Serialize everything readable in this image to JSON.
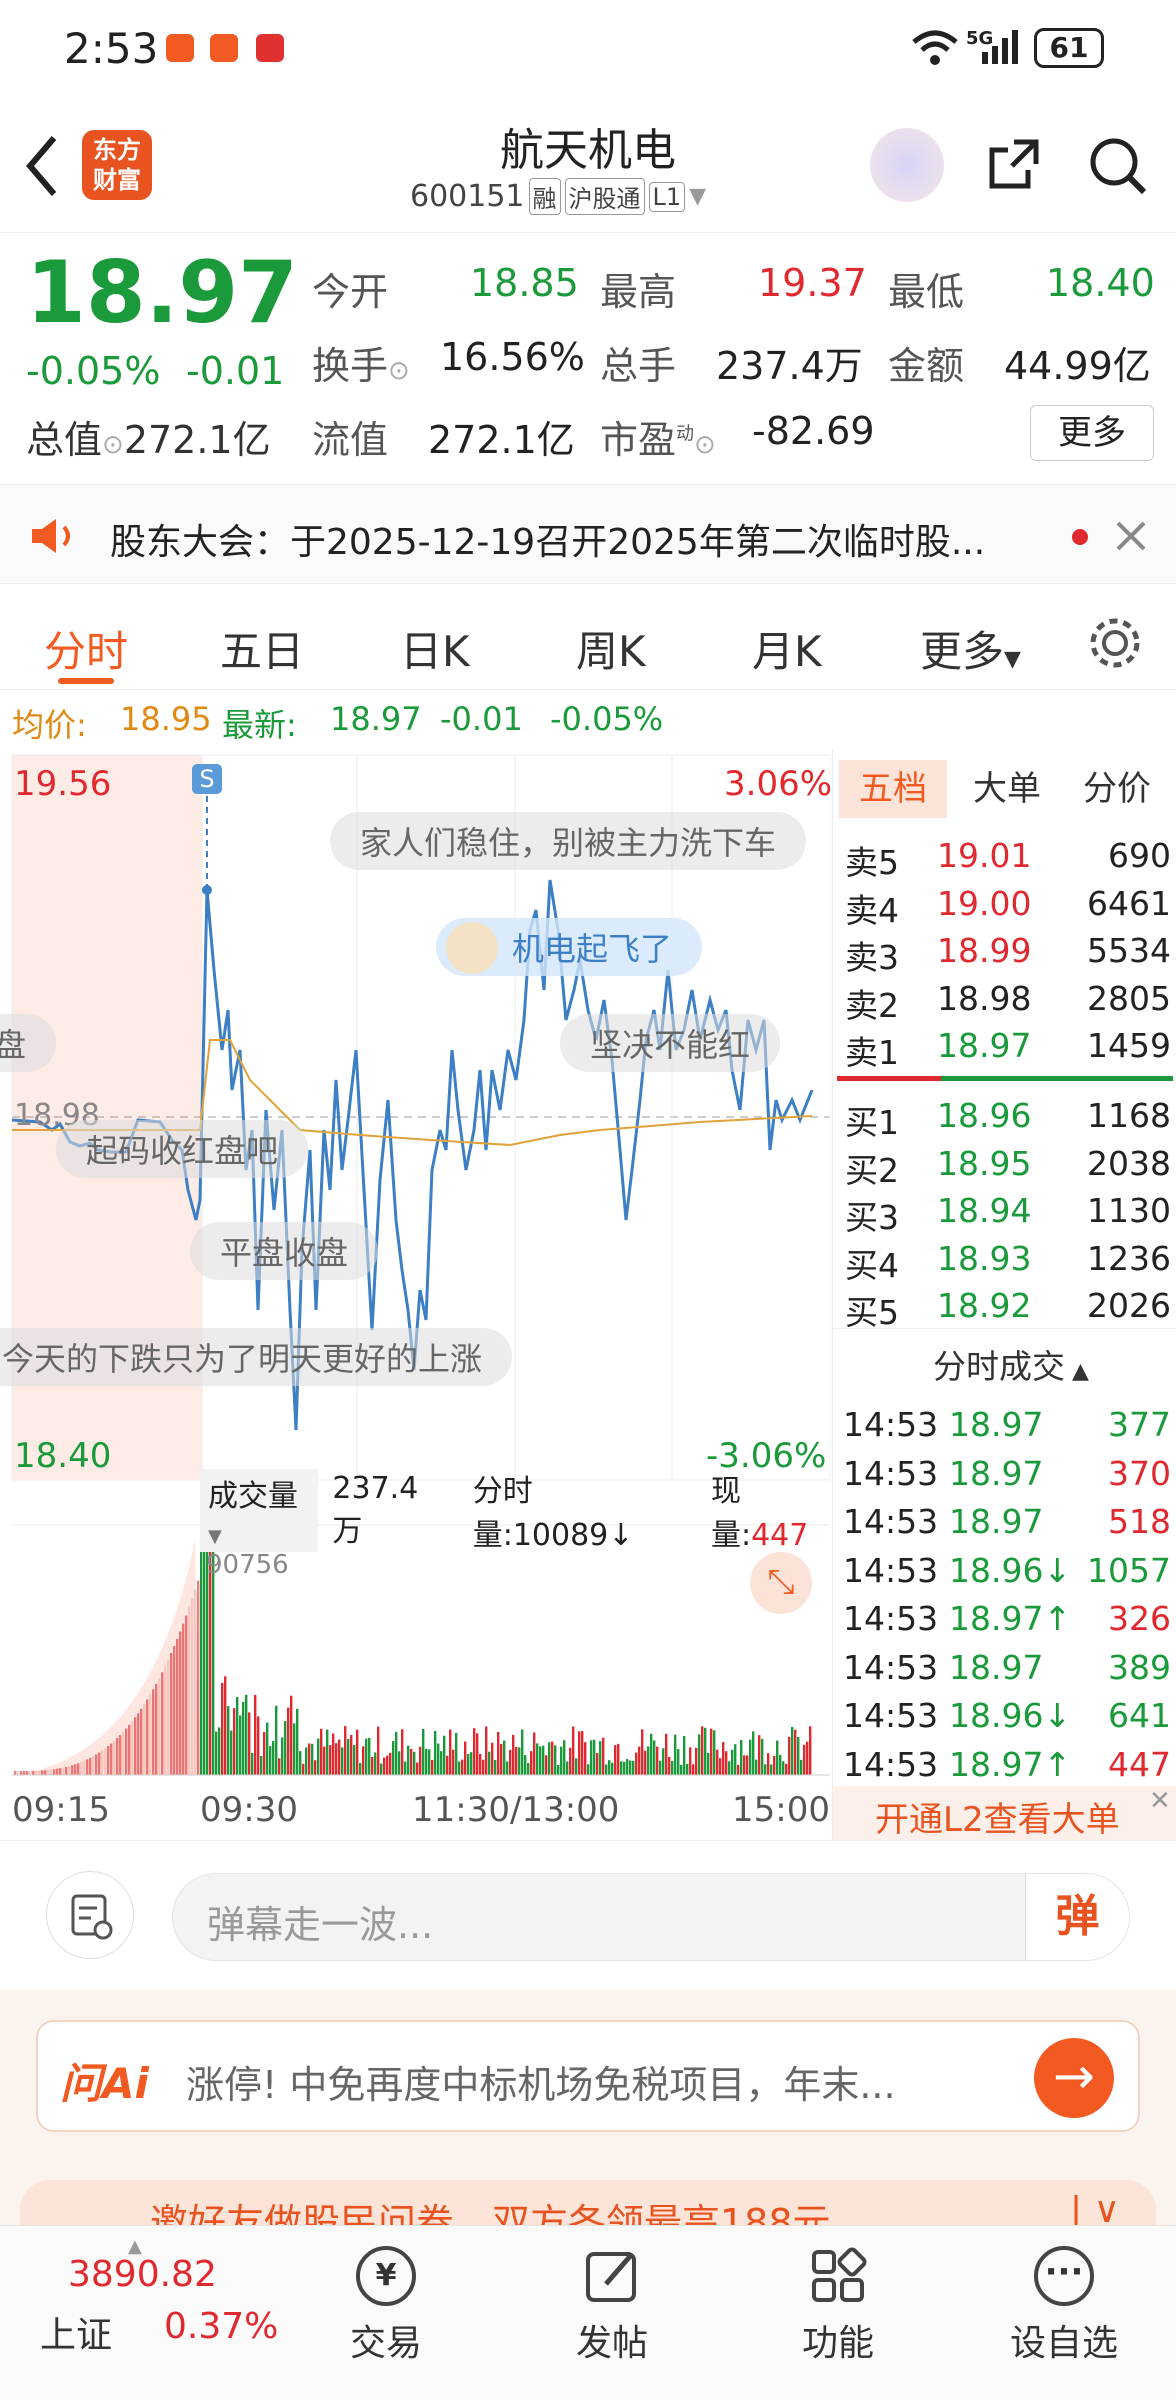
{
  "status": {
    "time": "2:53",
    "battery": "61",
    "network": "5G"
  },
  "header": {
    "logo_text_1": "东方",
    "logo_text_2": "财富",
    "title": "航天机电",
    "code": "600151",
    "tag_rong": "融",
    "tag_hgt": "沪股通",
    "tag_l1": "L1"
  },
  "quote": {
    "price": "18.97",
    "change_pct": "-0.05%",
    "change": "-0.01",
    "open_label": "今开",
    "open": "18.85",
    "high_label": "最高",
    "high": "19.37",
    "low_label": "最低",
    "low": "18.40",
    "turnover_label": "换手",
    "turnover": "16.56%",
    "volume_label": "总手",
    "volume": "237.4万",
    "amount_label": "金额",
    "amount": "44.99亿",
    "mktcap_label": "总值",
    "mktcap": "272.1亿",
    "float_label": "流值",
    "float": "272.1亿",
    "pe_label": "市盈",
    "pe_sup": "动",
    "pe": "-82.69",
    "more_button": "更多"
  },
  "notice": {
    "text": "股东大会：于2025-12-19召开2025年第二次临时股..."
  },
  "tabs": [
    "分时",
    "五日",
    "日K",
    "周K",
    "月K",
    "更多"
  ],
  "avg": {
    "avg_label": "均价:",
    "avg_value": "18.95",
    "latest_label": "最新:",
    "latest_value": "18.97",
    "chg": "-0.01",
    "pct": "-0.05%"
  },
  "chart_axes": {
    "max": "19.56",
    "min": "18.40",
    "mid": "18.98",
    "pct_max": "3.06%",
    "pct_min": "-3.06%",
    "s_marker": "S"
  },
  "danmu": [
    "家人们稳住，别被主力洗下车",
    "机电起飞了",
    "坚决不能红",
    "起码收红盘吧",
    "平盘收盘",
    "今天的下跌只为了明天更好的上涨",
    "盘"
  ],
  "volume_bar": {
    "label": "成交量",
    "total": "237.4万",
    "fen_label": "分时量:10089↓",
    "now_label": "现量:",
    "now_value": "447",
    "peak": "90756"
  },
  "time_axis": [
    "09:15",
    "09:30",
    "11:30/13:00",
    "15:00"
  ],
  "book": {
    "tabs": [
      "五档",
      "大单",
      "分价"
    ],
    "asks": [
      {
        "label": "卖5",
        "price": "19.01",
        "vol": "690"
      },
      {
        "label": "卖4",
        "price": "19.00",
        "vol": "6461"
      },
      {
        "label": "卖3",
        "price": "18.99",
        "vol": "5534"
      },
      {
        "label": "卖2",
        "price": "18.98",
        "vol": "2805"
      },
      {
        "label": "卖1",
        "price": "18.97",
        "vol": "1459"
      }
    ],
    "bids": [
      {
        "label": "买1",
        "price": "18.96",
        "vol": "1168"
      },
      {
        "label": "买2",
        "price": "18.95",
        "vol": "2038"
      },
      {
        "label": "买3",
        "price": "18.94",
        "vol": "1130"
      },
      {
        "label": "买4",
        "price": "18.93",
        "vol": "1236"
      },
      {
        "label": "买5",
        "price": "18.92",
        "vol": "2026"
      }
    ],
    "ticks_title": "分时成交",
    "ticks": [
      {
        "t": "14:53",
        "p": "18.97",
        "v": "377"
      },
      {
        "t": "14:53",
        "p": "18.97",
        "v": "370"
      },
      {
        "t": "14:53",
        "p": "18.97",
        "v": "518"
      },
      {
        "t": "14:53",
        "p": "18.96↓",
        "v": "1057"
      },
      {
        "t": "14:53",
        "p": "18.97↑",
        "v": "326"
      },
      {
        "t": "14:53",
        "p": "18.97",
        "v": "389"
      },
      {
        "t": "14:53",
        "p": "18.96↓",
        "v": "641"
      },
      {
        "t": "14:53",
        "p": "18.97↑",
        "v": "447"
      }
    ],
    "l2_promo": "开通L2查看大单"
  },
  "input": {
    "placeholder": "弹幕走一波...",
    "danmu_btn": "弹"
  },
  "ai": {
    "logo": "问Ai",
    "text": "涨停! 中免再度中标机场免税项目，年末...",
    "promo": "邀好友做股民问卷，双方各领最高188元"
  },
  "bottom": {
    "index_value": "3890.82",
    "index_name": "上证",
    "index_pct": "0.37%",
    "nav": [
      "交易",
      "发帖",
      "功能",
      "设自选"
    ]
  }
}
